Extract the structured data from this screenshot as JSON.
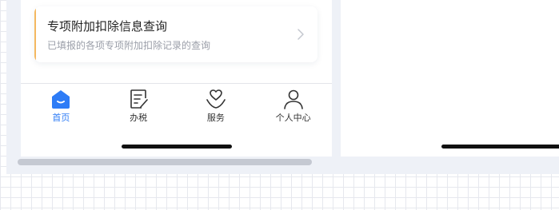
{
  "card": {
    "title": "专项附加扣除信息查询",
    "subtitle": "已填报的各项专项附加扣除记录的查询",
    "accent_color": "#f4b860"
  },
  "tabbar": {
    "active_color": "#2e7cf6",
    "items": [
      {
        "label": "首页",
        "icon": "home-icon",
        "active": true
      },
      {
        "label": "办税",
        "icon": "tax-form-icon",
        "active": false
      },
      {
        "label": "服务",
        "icon": "heart-hand-icon",
        "active": false
      },
      {
        "label": "个人中心",
        "icon": "person-icon",
        "active": false
      }
    ]
  }
}
